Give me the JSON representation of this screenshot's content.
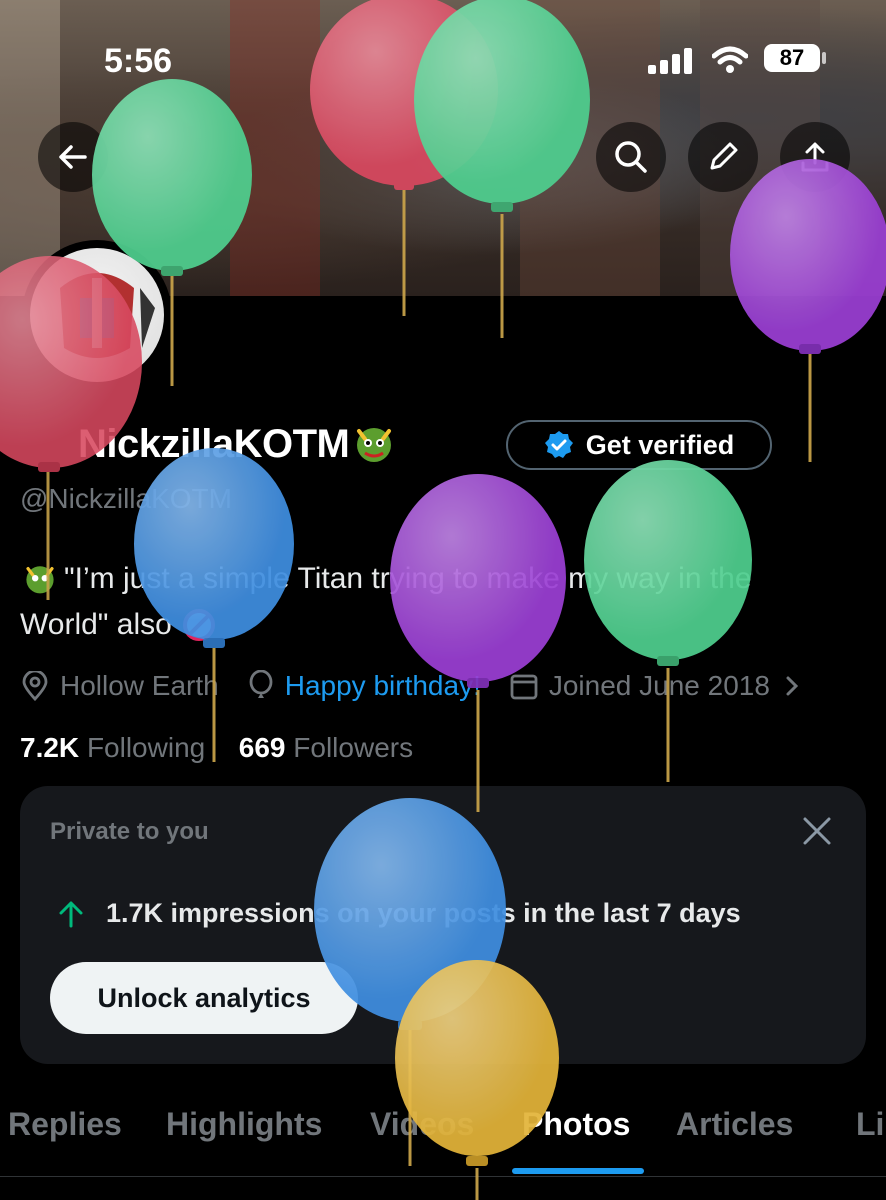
{
  "status_bar": {
    "time": "5:56",
    "battery": "87"
  },
  "header_icons": [
    "back-arrow-icon",
    "search-icon",
    "edit-pencil-icon",
    "share-icon"
  ],
  "profile": {
    "display_name": "NickzillaKOTM",
    "verify_label": "Get verified",
    "handle": "@NickzillaKOTM",
    "bio_line1": "\"I’m just a simple Titan trying to make my way in the",
    "bio_line2": "World\" also",
    "location": "Hollow Earth",
    "birthday": "Happy birthday!",
    "joined": "Joined June 2018",
    "following_count": "7.2K",
    "following_label": "Following",
    "followers_count": "669",
    "followers_label": "Followers"
  },
  "analytics_card": {
    "title": "Private to you",
    "stat": "1.7K impressions on your posts in the last 7 days",
    "button": "Unlock analytics"
  },
  "tabs": [
    {
      "label": "Replies",
      "active": false
    },
    {
      "label": "Highlights",
      "active": false
    },
    {
      "label": "Videos",
      "active": false
    },
    {
      "label": "Photos",
      "active": true
    },
    {
      "label": "Articles",
      "active": false
    },
    {
      "label": "Li",
      "active": false
    }
  ],
  "colors": {
    "accent": "#1d9bf0",
    "balloon_red": "#d8485f",
    "balloon_green": "#4fcf8f",
    "balloon_purple": "#9b3fd4",
    "balloon_blue": "#3f8ee0",
    "balloon_yellow": "#e3b43a"
  }
}
